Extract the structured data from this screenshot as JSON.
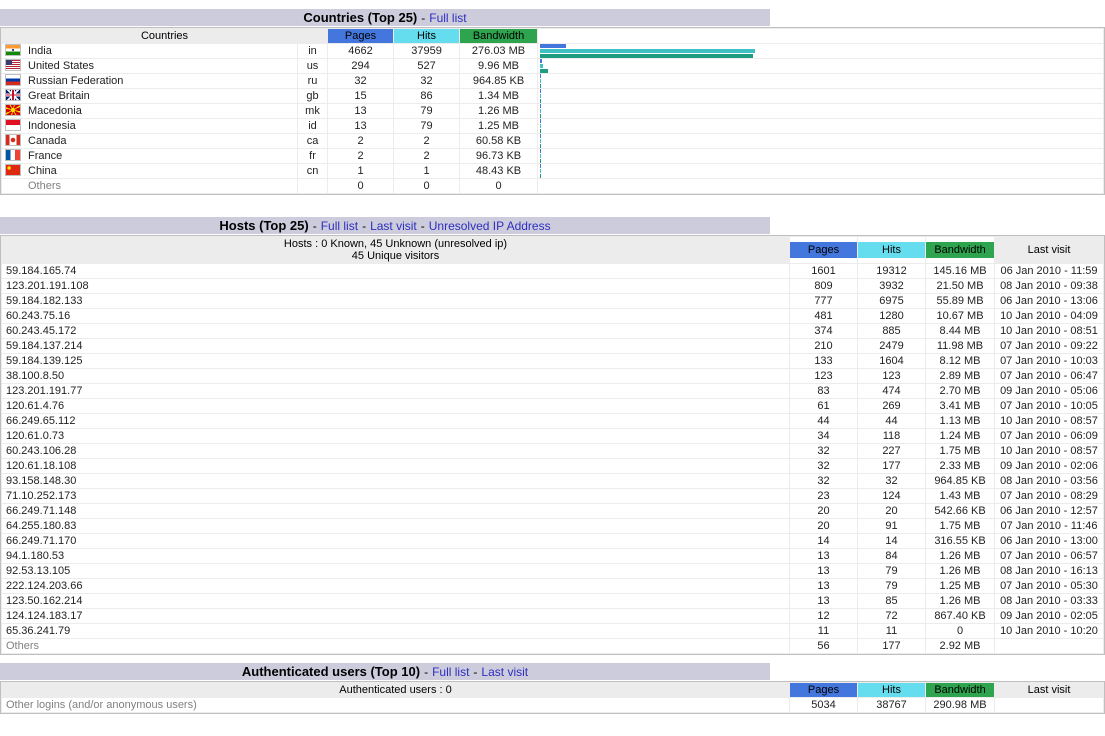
{
  "colors": {
    "title_bar_bg": "#CCCCDD",
    "header_gray_bg": "#ECECEC",
    "pages_color": "#4477DD",
    "hits_color": "#66DDEE",
    "bandwidth_color": "#2EA44E",
    "pages_bar_color": "#4477DD",
    "hits_bar_color": "#3FC0C4",
    "bandwidth_bar_color": "#1C9C80",
    "link_color": "#2E2EBE",
    "muted_text_color": "#808080"
  },
  "col_headers": {
    "pages": "Pages",
    "hits": "Hits",
    "bandwidth": "Bandwidth",
    "last_visit": "Last visit"
  },
  "countries": {
    "title": "Countries (Top 25)",
    "links": [
      "Full list"
    ],
    "name_header": "Countries",
    "rows": [
      {
        "flag": "in",
        "name": "India",
        "code": "in",
        "pages": 4662,
        "hits": 37959,
        "bandwidth": "276.03 MB",
        "bw_mb": 276.03
      },
      {
        "flag": "us",
        "name": "United States",
        "code": "us",
        "pages": 294,
        "hits": 527,
        "bandwidth": "9.96 MB",
        "bw_mb": 9.96
      },
      {
        "flag": "ru",
        "name": "Russian Federation",
        "code": "ru",
        "pages": 32,
        "hits": 32,
        "bandwidth": "964.85 KB",
        "bw_mb": 0.94
      },
      {
        "flag": "gb",
        "name": "Great Britain",
        "code": "gb",
        "pages": 15,
        "hits": 86,
        "bandwidth": "1.34 MB",
        "bw_mb": 1.34
      },
      {
        "flag": "mk",
        "name": "Macedonia",
        "code": "mk",
        "pages": 13,
        "hits": 79,
        "bandwidth": "1.26 MB",
        "bw_mb": 1.26
      },
      {
        "flag": "id",
        "name": "Indonesia",
        "code": "id",
        "pages": 13,
        "hits": 79,
        "bandwidth": "1.25 MB",
        "bw_mb": 1.25
      },
      {
        "flag": "ca",
        "name": "Canada",
        "code": "ca",
        "pages": 2,
        "hits": 2,
        "bandwidth": "60.58 KB",
        "bw_mb": 0.059
      },
      {
        "flag": "fr",
        "name": "France",
        "code": "fr",
        "pages": 2,
        "hits": 2,
        "bandwidth": "96.73 KB",
        "bw_mb": 0.094
      },
      {
        "flag": "cn",
        "name": "China",
        "code": "cn",
        "pages": 1,
        "hits": 1,
        "bandwidth": "48.43 KB",
        "bw_mb": 0.047
      },
      {
        "flag": "",
        "name": "Others",
        "code": "",
        "pages": 0,
        "hits": 0,
        "bandwidth": "0",
        "bw_mb": 0,
        "muted": true
      }
    ]
  },
  "hosts": {
    "title": "Hosts (Top 25)",
    "links": [
      "Full list",
      "Last visit",
      "Unresolved IP Address"
    ],
    "summary_line1": "Hosts : 0 Known, 45 Unknown (unresolved ip)",
    "summary_line2": "45 Unique visitors",
    "rows": [
      {
        "host": "59.184.165.74",
        "pages": 1601,
        "hits": 19312,
        "bandwidth": "145.16 MB",
        "last_visit": "06 Jan 2010 - 11:59"
      },
      {
        "host": "123.201.191.108",
        "pages": 809,
        "hits": 3932,
        "bandwidth": "21.50 MB",
        "last_visit": "08 Jan 2010 - 09:38"
      },
      {
        "host": "59.184.182.133",
        "pages": 777,
        "hits": 6975,
        "bandwidth": "55.89 MB",
        "last_visit": "06 Jan 2010 - 13:06"
      },
      {
        "host": "60.243.75.16",
        "pages": 481,
        "hits": 1280,
        "bandwidth": "10.67 MB",
        "last_visit": "10 Jan 2010 - 04:09"
      },
      {
        "host": "60.243.45.172",
        "pages": 374,
        "hits": 885,
        "bandwidth": "8.44 MB",
        "last_visit": "10 Jan 2010 - 08:51"
      },
      {
        "host": "59.184.137.214",
        "pages": 210,
        "hits": 2479,
        "bandwidth": "11.98 MB",
        "last_visit": "07 Jan 2010 - 09:22"
      },
      {
        "host": "59.184.139.125",
        "pages": 133,
        "hits": 1604,
        "bandwidth": "8.12 MB",
        "last_visit": "07 Jan 2010 - 10:03"
      },
      {
        "host": "38.100.8.50",
        "pages": 123,
        "hits": 123,
        "bandwidth": "2.89 MB",
        "last_visit": "07 Jan 2010 - 06:47"
      },
      {
        "host": "123.201.191.77",
        "pages": 83,
        "hits": 474,
        "bandwidth": "2.70 MB",
        "last_visit": "09 Jan 2010 - 05:06"
      },
      {
        "host": "120.61.4.76",
        "pages": 61,
        "hits": 269,
        "bandwidth": "3.41 MB",
        "last_visit": "07 Jan 2010 - 10:05"
      },
      {
        "host": "66.249.65.112",
        "pages": 44,
        "hits": 44,
        "bandwidth": "1.13 MB",
        "last_visit": "10 Jan 2010 - 08:57"
      },
      {
        "host": "120.61.0.73",
        "pages": 34,
        "hits": 118,
        "bandwidth": "1.24 MB",
        "last_visit": "07 Jan 2010 - 06:09"
      },
      {
        "host": "60.243.106.28",
        "pages": 32,
        "hits": 227,
        "bandwidth": "1.75 MB",
        "last_visit": "10 Jan 2010 - 08:57"
      },
      {
        "host": "120.61.18.108",
        "pages": 32,
        "hits": 177,
        "bandwidth": "2.33 MB",
        "last_visit": "09 Jan 2010 - 02:06"
      },
      {
        "host": "93.158.148.30",
        "pages": 32,
        "hits": 32,
        "bandwidth": "964.85 KB",
        "last_visit": "08 Jan 2010 - 03:56"
      },
      {
        "host": "71.10.252.173",
        "pages": 23,
        "hits": 124,
        "bandwidth": "1.43 MB",
        "last_visit": "07 Jan 2010 - 08:29"
      },
      {
        "host": "66.249.71.148",
        "pages": 20,
        "hits": 20,
        "bandwidth": "542.66 KB",
        "last_visit": "06 Jan 2010 - 12:57"
      },
      {
        "host": "64.255.180.83",
        "pages": 20,
        "hits": 91,
        "bandwidth": "1.75 MB",
        "last_visit": "07 Jan 2010 - 11:46"
      },
      {
        "host": "66.249.71.170",
        "pages": 14,
        "hits": 14,
        "bandwidth": "316.55 KB",
        "last_visit": "06 Jan 2010 - 13:00"
      },
      {
        "host": "94.1.180.53",
        "pages": 13,
        "hits": 84,
        "bandwidth": "1.26 MB",
        "last_visit": "07 Jan 2010 - 06:57"
      },
      {
        "host": "92.53.13.105",
        "pages": 13,
        "hits": 79,
        "bandwidth": "1.26 MB",
        "last_visit": "08 Jan 2010 - 16:13"
      },
      {
        "host": "222.124.203.66",
        "pages": 13,
        "hits": 79,
        "bandwidth": "1.25 MB",
        "last_visit": "07 Jan 2010 - 05:30"
      },
      {
        "host": "123.50.162.214",
        "pages": 13,
        "hits": 85,
        "bandwidth": "1.26 MB",
        "last_visit": "08 Jan 2010 - 03:33"
      },
      {
        "host": "124.124.183.17",
        "pages": 12,
        "hits": 72,
        "bandwidth": "867.40 KB",
        "last_visit": "09 Jan 2010 - 02:05"
      },
      {
        "host": "65.36.241.79",
        "pages": 11,
        "hits": 11,
        "bandwidth": "0",
        "last_visit": "10 Jan 2010 - 10:20"
      },
      {
        "host": "Others",
        "pages": 56,
        "hits": 177,
        "bandwidth": "2.92 MB",
        "last_visit": "",
        "muted": true
      }
    ]
  },
  "auth": {
    "title": "Authenticated users (Top 10)",
    "links": [
      "Full list",
      "Last visit"
    ],
    "summary": "Authenticated users : 0",
    "row": {
      "label": "Other logins (and/or anonymous users)",
      "pages": "5034",
      "hits": "38767",
      "bandwidth": "290.98 MB",
      "last_visit": ""
    }
  }
}
